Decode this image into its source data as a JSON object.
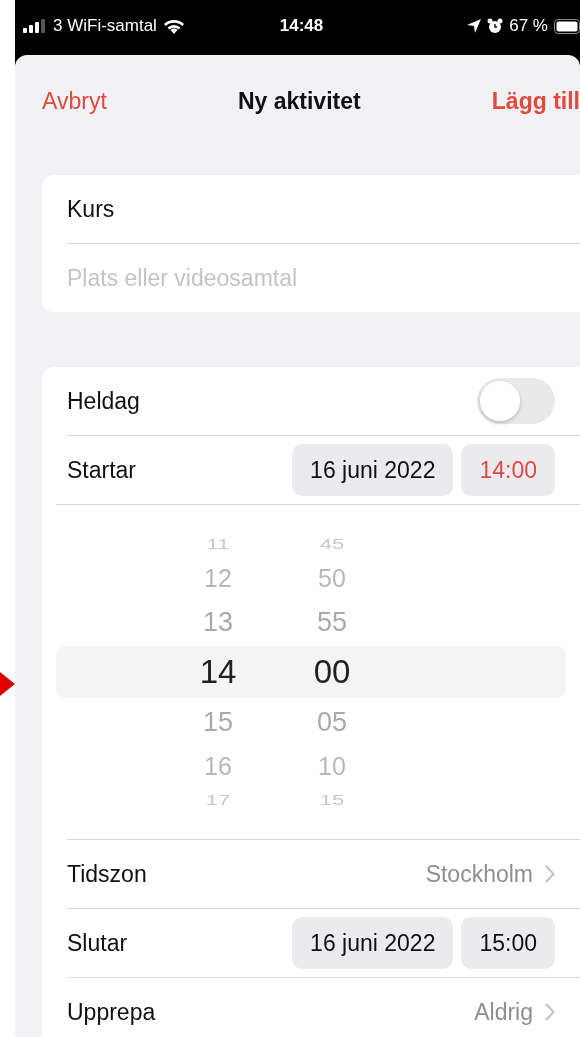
{
  "status_bar": {
    "carrier": "3 WiFi-samtal",
    "time": "14:48",
    "battery": "67 %"
  },
  "nav": {
    "cancel": "Avbryt",
    "title": "Ny aktivitet",
    "add": "Lägg till"
  },
  "details": {
    "title": "Kurs",
    "location_placeholder": "Plats eller videosamtal"
  },
  "rows": [
    {
      "kind": "toggle",
      "label": "Heldag",
      "on": false
    },
    {
      "kind": "datetime",
      "label": "Startar",
      "date": "16 juni 2022",
      "time": "14:00",
      "active": true
    },
    {
      "kind": "picker",
      "items": [
        {
          "hour": "11",
          "minute": "45",
          "selected": false
        },
        {
          "hour": "12",
          "minute": "50",
          "selected": false
        },
        {
          "hour": "13",
          "minute": "55",
          "selected": false
        },
        {
          "hour": "14",
          "minute": "00",
          "selected": true
        },
        {
          "hour": "15",
          "minute": "05",
          "selected": false
        },
        {
          "hour": "16",
          "minute": "10",
          "selected": false
        },
        {
          "hour": "17",
          "minute": "15",
          "selected": false
        }
      ]
    },
    {
      "kind": "detail",
      "label": "Tidszon",
      "value": "Stockholm"
    },
    {
      "kind": "datetime",
      "label": "Slutar",
      "date": "16 juni 2022",
      "time": "15:00",
      "active": false
    },
    {
      "kind": "detail",
      "label": "Upprepa",
      "value": "Aldrig"
    }
  ]
}
